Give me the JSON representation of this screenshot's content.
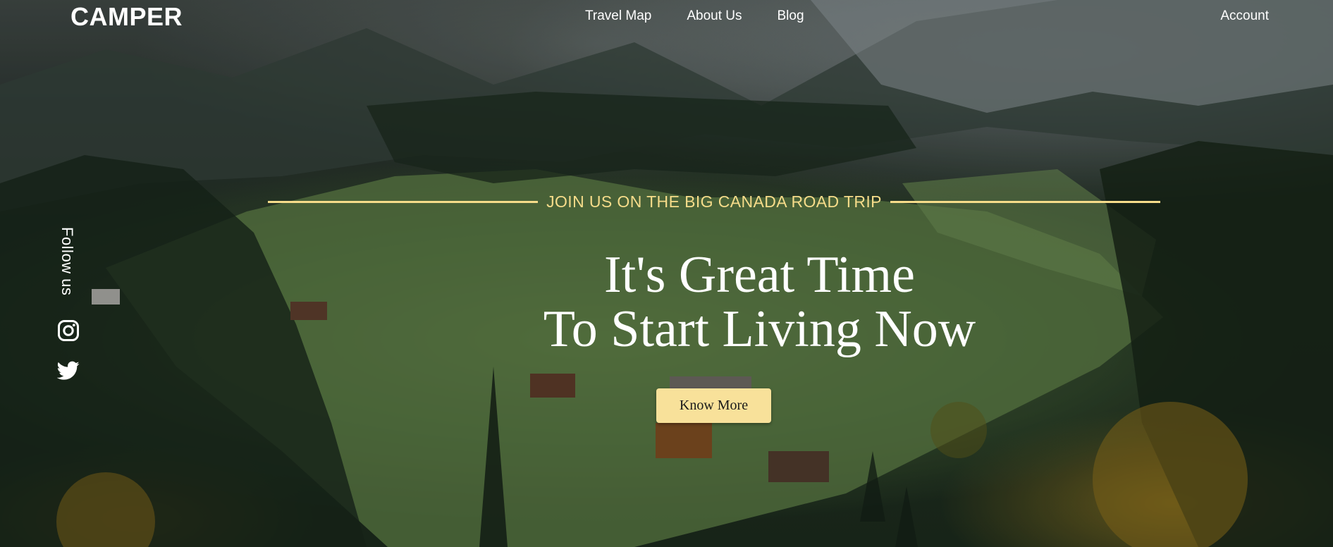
{
  "header": {
    "logo": "CAMPER",
    "nav": [
      "Travel Map",
      "About Us",
      "Blog"
    ],
    "account_label": "Account"
  },
  "social": {
    "follow_label": "Follow us",
    "icons": [
      "instagram-icon",
      "twitter-icon"
    ]
  },
  "hero": {
    "eyebrow": "JOIN US ON THE BIG CANADA ROAD TRIP",
    "headline_line1": "It's Great Time",
    "headline_line2": "To Start Living Now",
    "cta_label": "Know More"
  },
  "colors": {
    "accent": "#f6dc8a",
    "button_bg": "#f8e19a",
    "text": "#ffffff"
  }
}
